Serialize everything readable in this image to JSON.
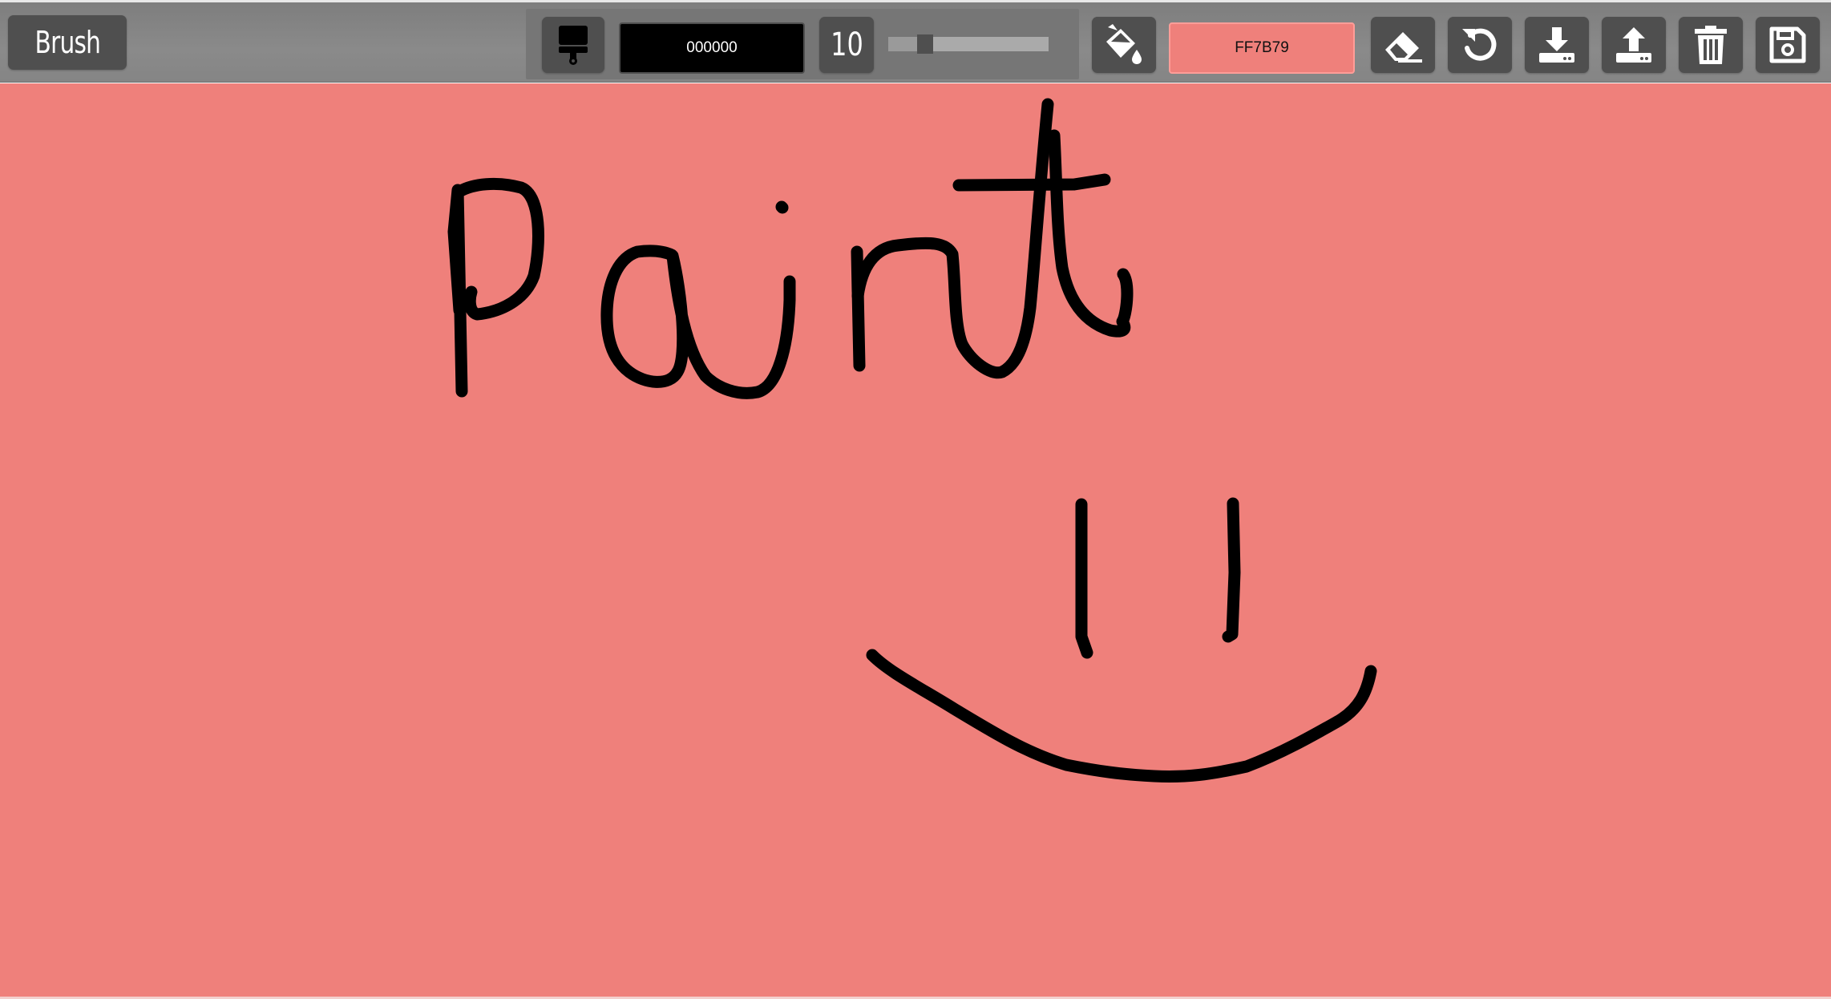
{
  "toolbar": {
    "tool_label": "Brush",
    "brush_color_value": "000000",
    "brush_size": "10",
    "brush_size_slider_fraction": 0.2,
    "background_color_value": "FF7B79",
    "icons": {
      "brush": "paintbrush-icon",
      "fill": "paint-bucket-icon",
      "eraser": "eraser-icon",
      "undo": "undo-icon",
      "download": "download-icon",
      "upload": "upload-icon",
      "clear": "trash-icon",
      "save": "save-floppy-icon"
    }
  },
  "canvas": {
    "background_color": "#ef807b",
    "stroke_color": "#000000"
  }
}
